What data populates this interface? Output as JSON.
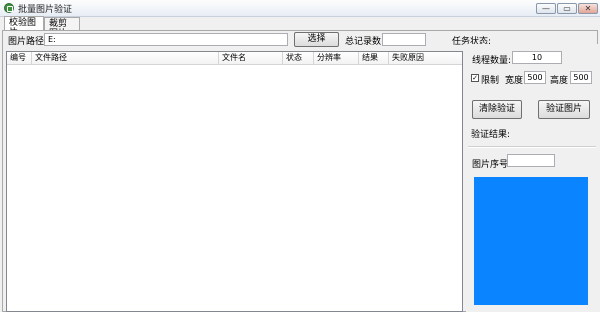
{
  "window": {
    "title": "批量图片验证",
    "controls": {
      "minimize": "—",
      "restore": "▭",
      "close": "✕"
    }
  },
  "tabs": [
    {
      "label": "校验图片",
      "active": true
    },
    {
      "label": "裁剪图片",
      "active": false
    }
  ],
  "top_bar": {
    "path_label": "图片路径:",
    "path_value": "E:",
    "select_button": "选择",
    "total_label": "总记录数:",
    "total_value": "",
    "task_status_label": "任务状态:"
  },
  "table": {
    "columns": [
      "编号",
      "文件路径",
      "文件名",
      "状态",
      "分辨率",
      "结果",
      "失败原因"
    ],
    "rows": []
  },
  "right_panel": {
    "threads_label": "线程数量:",
    "threads_value": "10",
    "limit_label": "限制",
    "limit_checked": true,
    "width_label": "宽度",
    "width_value": "500",
    "height_label": "高度",
    "height_value": "500",
    "clear_button": "清除验证",
    "verify_button": "验证图片",
    "result_label": "验证结果:",
    "image_index_label": "图片序号",
    "image_index_value": ""
  },
  "colors": {
    "preview": "#0a84ff"
  }
}
